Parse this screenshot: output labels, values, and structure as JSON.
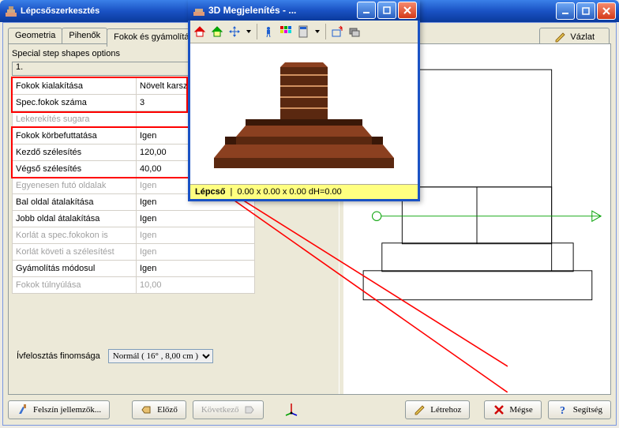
{
  "main_window": {
    "title": "Lépcsőszerkesztés"
  },
  "tabs": [
    "Geometria",
    "Pihenők",
    "Fokok és gyámolítás"
  ],
  "right_tab": "Vázlat",
  "options_title": "Special step shapes options",
  "first_row": "1.",
  "rows": [
    {
      "label": "Fokok kialakítása",
      "value": "Növelt karszéle",
      "gray": false
    },
    {
      "label": "Spec.fokok száma",
      "value": "3",
      "gray": false
    },
    {
      "label": "Lekerekítés sugara",
      "value": "",
      "gray": true
    },
    {
      "label": "Fokok körbefuttatása",
      "value": "Igen",
      "gray": false
    },
    {
      "label": "Kezdő szélesítés",
      "value": "120,00",
      "gray": false
    },
    {
      "label": "Végső szélesítés",
      "value": "40,00",
      "gray": false
    },
    {
      "label": "Egyenesen futó oldalak",
      "value": "Igen",
      "gray": true
    },
    {
      "label": "Bal oldal átalakítása",
      "value": "Igen",
      "gray": false
    },
    {
      "label": "Jobb oldal átalakítása",
      "value": "Igen",
      "gray": false
    },
    {
      "label": "Korlát a spec.fokokon is",
      "value": "Igen",
      "gray": true
    },
    {
      "label": "Korlát követi a szélesítést",
      "value": "Igen",
      "gray": true
    },
    {
      "label": "Gyámolítás módosul",
      "value": "Igen",
      "gray": false
    },
    {
      "label": "Fokok túlnyúlása",
      "value": "10,00",
      "gray": true
    }
  ],
  "resolution": {
    "label": "Ívfelosztás finomsága",
    "selected": "Normál ( 16° , 8,00 cm )"
  },
  "buttons": {
    "surface": "Felszín jellemzők...",
    "prev": "Előző",
    "next": "Következő",
    "create": "Létrehoz",
    "cancel": "Mégse",
    "help": "Segítség"
  },
  "preview": {
    "title": "3D Megjelenítés - ...",
    "status_label": "Lépcső",
    "status_dims": "0.00 x 0.00 x 0.00 dH=0.00"
  }
}
